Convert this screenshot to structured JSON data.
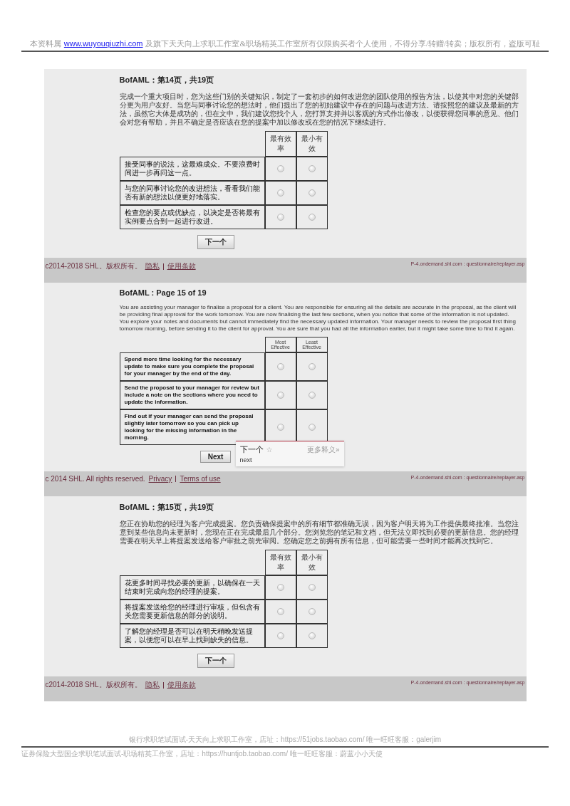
{
  "page_header": {
    "prefix": "本资料属",
    "link": "www.wuyouqiuzhi.com",
    "suffix": "及旗下天天向上求职工作室&职场精英工作室所有仅限购买者个人使用，不得分享/转赠/转卖；版权所有，盗版可耻"
  },
  "screens": [
    {
      "title": "BofAML：第14页，共19页",
      "intro": "完成一个重大项目时，您为这些门别的关键知识，制定了一套初步的如何改进您的团队使用的报告方法，以使其中对您的关键部分更为用户友好。当您与同事讨论您的想法时，他们提出了您的初始建议中存在的问题与改进方法。请按照您的建议及最新的方法，虽然它大体是成功的，但在文中，我们建议您找个人，您打算支持并以客观的方式作出修改，以便获得您同事的意见、他们会对您有帮助，并且不确定是否应该在您的提案中加以修改或在您的情况下继续进行。",
      "columns": [
        "最有效率",
        "最小有效"
      ],
      "options": [
        {
          "text": "接受同事的说法，这最难成众。不要浪费时间进一步再问这一点。",
          "most_selected": false,
          "least_selected": false
        },
        {
          "text": "与您的同事讨论您的改进想法，看看我们能否有新的想法以便更好地落实。",
          "most_selected": false,
          "least_selected": false
        },
        {
          "text": "检查您的要点或优缺点，以决定是否将最有实例要点合到一起进行改进。",
          "most_selected": false,
          "least_selected": false
        }
      ],
      "next_button": "下一个",
      "footer": {
        "copyright": "c2014-2018 SHL。版权所有。",
        "links": [
          "隐私",
          "使用条款"
        ],
        "server": "P-4.ondemand.shl.com : questionnaire/replayer.asp"
      }
    },
    {
      "title": "BofAML : Page 15 of 19",
      "intro": "You are assisting your manager to finalise a proposal for a client. You are responsible for ensuring all the details are accurate in the proposal, as the client will be providing final approval for the work tomorrow. You are now finalising the last few sections, when you notice that some of the information is not updated. You explore your notes and documents but cannot immediately find the necessary updated information. Your manager needs to review the proposal first thing tomorrow morning, before sending it to the client for approval. You are sure that you had all the information earlier, but it might take some time to find it again.",
      "columns": [
        "Most Effective",
        "Least Effective"
      ],
      "options": [
        {
          "text": "Spend more time looking for the necessary update to make sure you complete the proposal for your manager by the end of the day.",
          "most_selected": false,
          "least_selected": false
        },
        {
          "text": "Send the proposal to your manager for review but include a note on the sections where you need to update the information.",
          "most_selected": false,
          "least_selected": false
        },
        {
          "text": "Find out if your manager can send the proposal slightly later tomorrow so you can pick up looking for the missing information in the morning.",
          "most_selected": false,
          "least_selected": false
        }
      ],
      "next_button": "Next",
      "popup": {
        "word": "下一个",
        "star": "☆",
        "more": "更多释义»",
        "translation": "next"
      },
      "footer": {
        "copyright": "c 2014 SHL. All rights reserved.",
        "links": [
          "Privacy",
          "Terms of use"
        ],
        "server": "P-4.ondemand.shl.com : questionnaire/replayer.asp"
      }
    },
    {
      "title": "BofAML：第15页，共19页",
      "intro": "您正在协助您的经理为客户完成提案。您负责确保提案中的所有细节都准确无误，因为客户明天将为工作提供最终批准。当您注意到某些信息尚未更新时，您现在正在完成最后几个部分。您浏览您的笔记和文档，但无法立即找到必要的更新信息。您的经理需要在明天早上将提案发送给客户审批之前先审阅。您确定您之前拥有所有信息，但可能需要一些时间才能再次找到它。",
      "columns": [
        "最有效率",
        "最小有效"
      ],
      "options": [
        {
          "text": "花更多时间寻找必要的更新，以确保在一天结束时完成向您的经理的提案。",
          "most_selected": false,
          "least_selected": false
        },
        {
          "text": "将提案发送给您的经理进行审核，但包含有关您需要更新信息的部分的说明。",
          "most_selected": false,
          "least_selected": false
        },
        {
          "text": "了解您的经理是否可以在明天稍晚发送提案，以便您可以在早上找到缺失的信息。",
          "most_selected": false,
          "least_selected": false
        }
      ],
      "next_button": "下一个",
      "footer": {
        "copyright": "c2014-2018 SHL。版权所有。",
        "links": [
          "隐私",
          "使用条款"
        ],
        "server": "P-4.ondemand.shl.com : questionnaire/replayer.asp"
      }
    }
  ],
  "page_footer": {
    "line_1": "银行求职笔试面试-天天向上求职工作室，店址：https://51jobs.taobao.com/  唯一旺旺客服：galerjim",
    "line_2": "证券保险大型国企求职笔试面试-职场精英工作室，店址：https://huntjob.taobao.com/  唯一旺旺客服：蔚蓝小小天使"
  }
}
